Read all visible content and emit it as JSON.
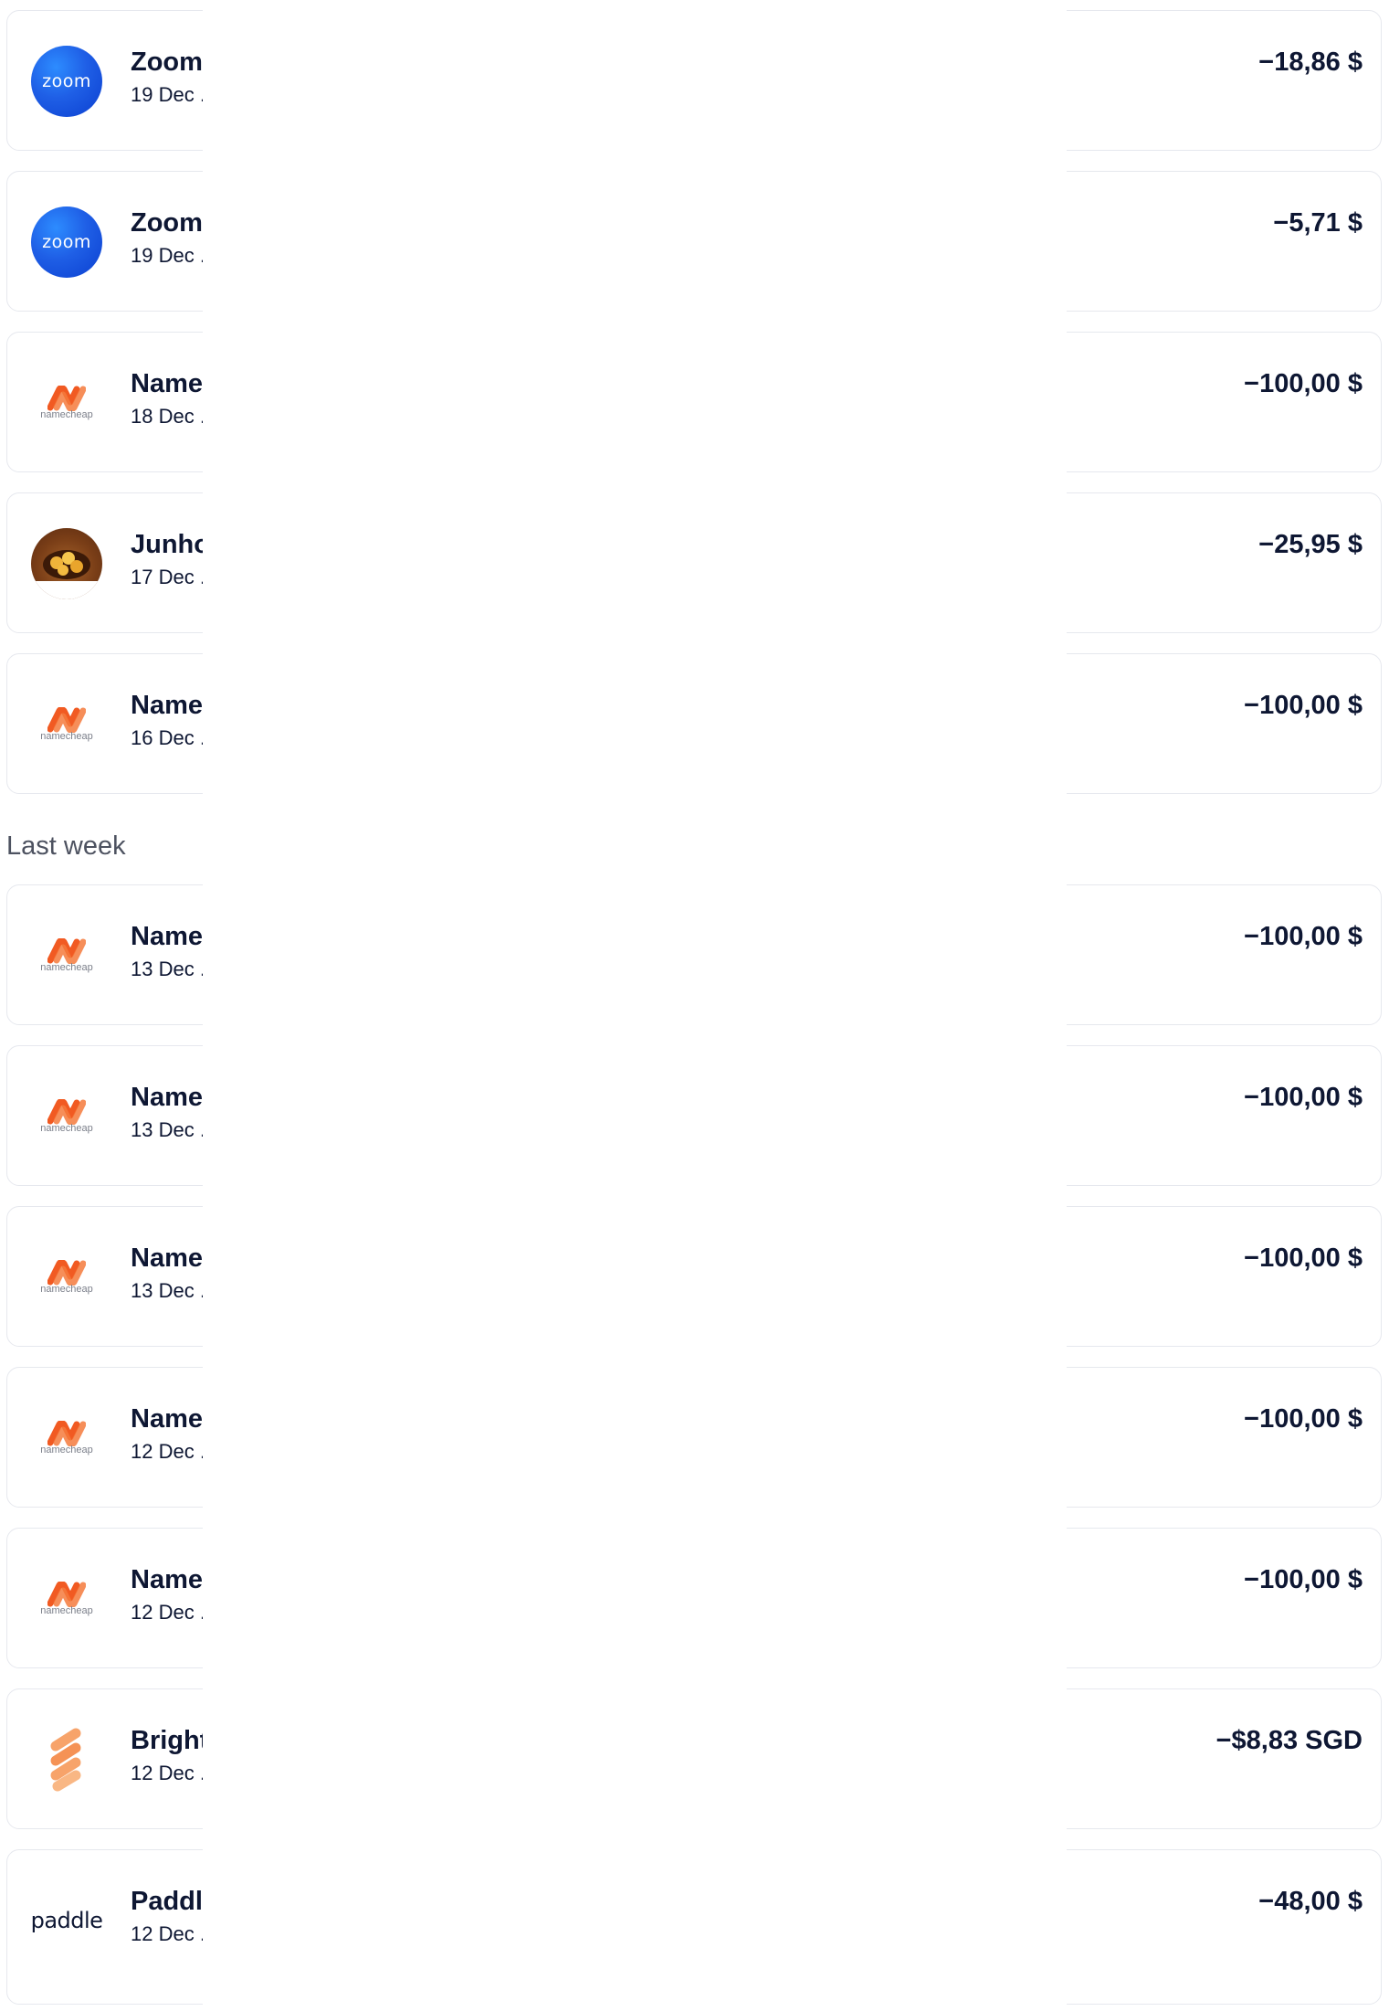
{
  "transactions_recent": [
    {
      "merchant": "Zoom",
      "date": "19 Dec .",
      "amount": "−18,86 $",
      "logo": "zoom-logo"
    },
    {
      "merchant": "Zoom",
      "date": "19 Dec .",
      "amount": "−5,71 $",
      "logo": "zoom-logo"
    },
    {
      "merchant": "Name",
      "date": "18 Dec .",
      "amount": "−100,00 $",
      "logo": "namecheap-logo"
    },
    {
      "merchant": "Junho",
      "date": "17 Dec .",
      "amount": "−25,95 $",
      "logo": "food-photo-logo"
    },
    {
      "merchant": "Name",
      "date": "16 Dec .",
      "amount": "−100,00 $",
      "logo": "namecheap-logo"
    }
  ],
  "section": {
    "heading": "Last week"
  },
  "transactions_last_week": [
    {
      "merchant": "Name",
      "date": "13 Dec .",
      "amount": "−100,00 $",
      "logo": "namecheap-logo"
    },
    {
      "merchant": "Name",
      "date": "13 Dec .",
      "amount": "−100,00 $",
      "logo": "namecheap-logo"
    },
    {
      "merchant": "Name",
      "date": "13 Dec .",
      "amount": "−100,00 $",
      "logo": "namecheap-logo"
    },
    {
      "merchant": "Name",
      "date": "12 Dec .",
      "amount": "−100,00 $",
      "logo": "namecheap-logo"
    },
    {
      "merchant": "Name",
      "date": "12 Dec .",
      "amount": "−100,00 $",
      "logo": "namecheap-logo"
    },
    {
      "merchant": "Bright",
      "date": "12 Dec .",
      "amount": "−$8,83 SGD",
      "logo": "brightdata-logo"
    },
    {
      "merchant": "Paddl",
      "date": "12 Dec .",
      "amount": "−48,00 $",
      "logo": "paddle-logo"
    }
  ],
  "logo_text": {
    "zoom": "zoom",
    "namecheap": "namecheap",
    "paddle": "paddle"
  },
  "colors": {
    "text": "#0e1733",
    "muted": "#4d5260",
    "border": "#e6e8ee",
    "zoom_blue": "#1f5fe6",
    "namecheap_orange": "#f15a22",
    "bright_orange": "#f7a36a"
  }
}
